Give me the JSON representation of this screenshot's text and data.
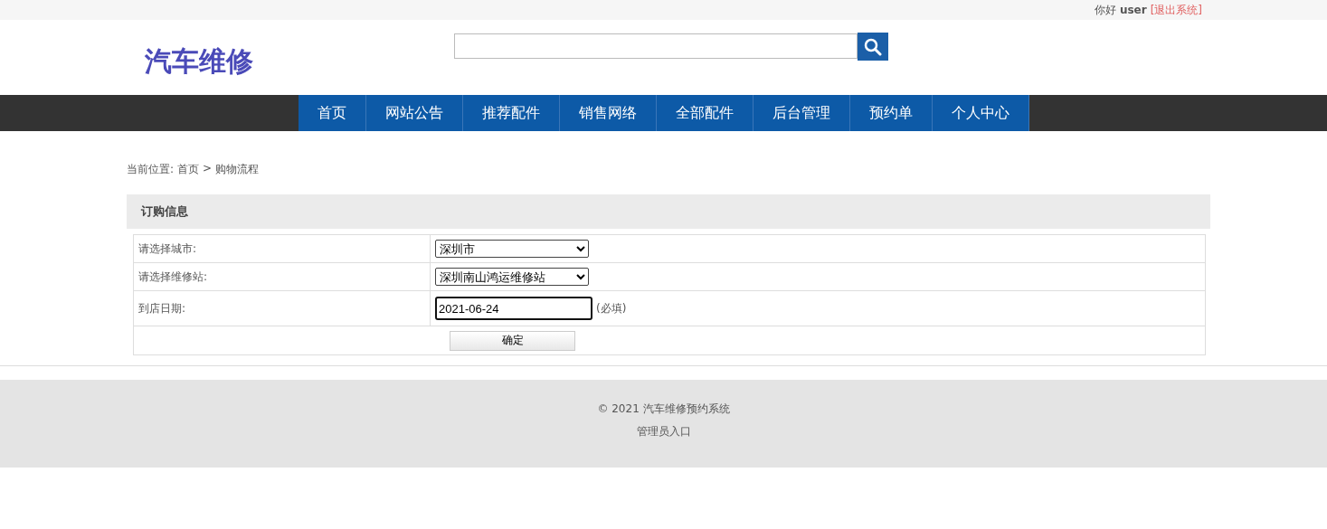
{
  "top_bar": {
    "greeting": "你好",
    "username": "user",
    "logout_link": "[退出系统]"
  },
  "header": {
    "logo": "汽车维修"
  },
  "nav": [
    {
      "label": "首页"
    },
    {
      "label": "网站公告"
    },
    {
      "label": "推荐配件"
    },
    {
      "label": "销售网络"
    },
    {
      "label": "全部配件"
    },
    {
      "label": "后台管理"
    },
    {
      "label": "预约单"
    },
    {
      "label": "个人中心"
    }
  ],
  "breadcrumb": {
    "prefix": "当前位置:",
    "home": "首页",
    "separator": ">",
    "current": "购物流程"
  },
  "panel": {
    "title": "订购信息",
    "rows": [
      {
        "kind": "select",
        "label": "请选择城市:",
        "value": "深圳市"
      },
      {
        "kind": "select",
        "label": "请选择维修站:",
        "value": "深圳南山鸿运维修站"
      },
      {
        "kind": "date",
        "label": "到店日期:",
        "value": "2021-06-24",
        "note": "(必填)"
      }
    ],
    "submit": "确定"
  },
  "footer": {
    "copyright": "© 2021 汽车维修预约系统",
    "admin_link": "管理员入口"
  }
}
